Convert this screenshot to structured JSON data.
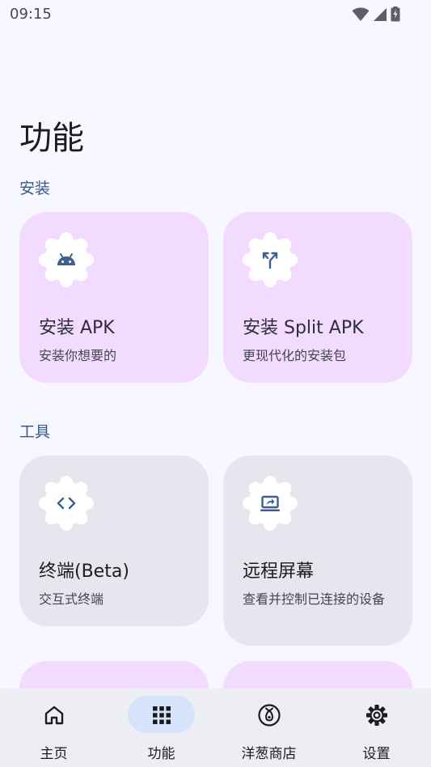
{
  "status_bar": {
    "time": "09:15",
    "icons": [
      "wifi-icon",
      "signal-icon",
      "battery-icon"
    ]
  },
  "page": {
    "title": "功能"
  },
  "sections": [
    {
      "label": "安装",
      "cards": [
        {
          "title": "安装 APK",
          "description": "安装你想要的",
          "icon": "android-icon"
        },
        {
          "title": "安装 Split APK",
          "description": "更现代化的安装包",
          "icon": "split-arrows-icon"
        }
      ]
    },
    {
      "label": "工具",
      "cards": [
        {
          "title": "终端(Beta)",
          "description": "交互式终端",
          "icon": "code-icon"
        },
        {
          "title": "远程屏幕",
          "description": "查看并控制已连接的设备",
          "icon": "screen-share-icon"
        }
      ]
    }
  ],
  "bottom_nav": {
    "active_index": 1,
    "items": [
      {
        "label": "主页",
        "icon": "home-icon"
      },
      {
        "label": "功能",
        "icon": "apps-grid-icon"
      },
      {
        "label": "洋葱商店",
        "icon": "onion-store-icon"
      },
      {
        "label": "设置",
        "icon": "gear-icon"
      }
    ]
  },
  "colors": {
    "background": "#f7f8ff",
    "section_label": "#36598c",
    "install_card": "#f3daff",
    "tool_card": "#e6e7ee",
    "nav_bar": "#eceef4",
    "nav_active_pill": "#d6e3fb",
    "icon_accent": "#3d5f91"
  }
}
